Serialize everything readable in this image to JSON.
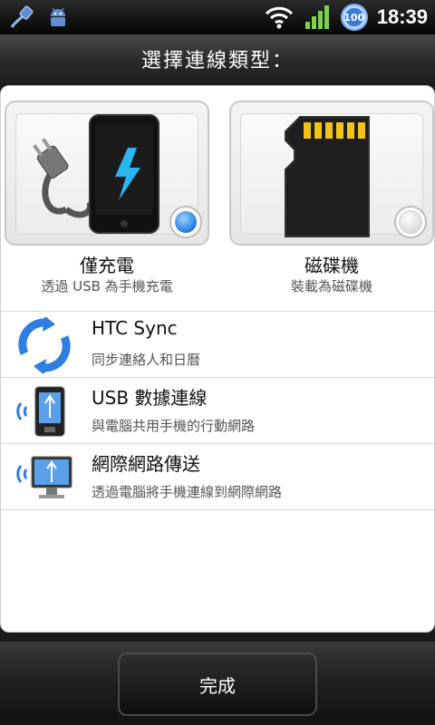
{
  "status_bar": {
    "left_icons": [
      "usb-cable-icon",
      "android-debug-icon"
    ],
    "right_icons": [
      "wifi-icon",
      "signal-icon"
    ],
    "battery_level": "100",
    "time": "18:39"
  },
  "title": "選擇連線類型：",
  "options": {
    "charge": {
      "label": "僅充電",
      "sub": "透過 USB 為手機充電",
      "icon": "phone-charging-icon",
      "selected": true
    },
    "disk": {
      "label": "磁碟機",
      "sub": "裝載為磁碟機",
      "icon": "sd-card-icon",
      "selected": false
    }
  },
  "list": [
    {
      "title": "HTC Sync",
      "sub": "同步連絡人和日曆",
      "icon": "sync-icon"
    },
    {
      "title": "USB 數據連線",
      "sub": "與電腦共用手機的行動網路",
      "icon": "usb-tethering-icon"
    },
    {
      "title": "網際網路傳送",
      "sub": "透過電腦將手機連線到網際網路",
      "icon": "internet-pass-through-icon"
    }
  ],
  "done_label": "完成",
  "colors": {
    "accent": "#1f7be0",
    "lightning": "#2ab4f0"
  }
}
